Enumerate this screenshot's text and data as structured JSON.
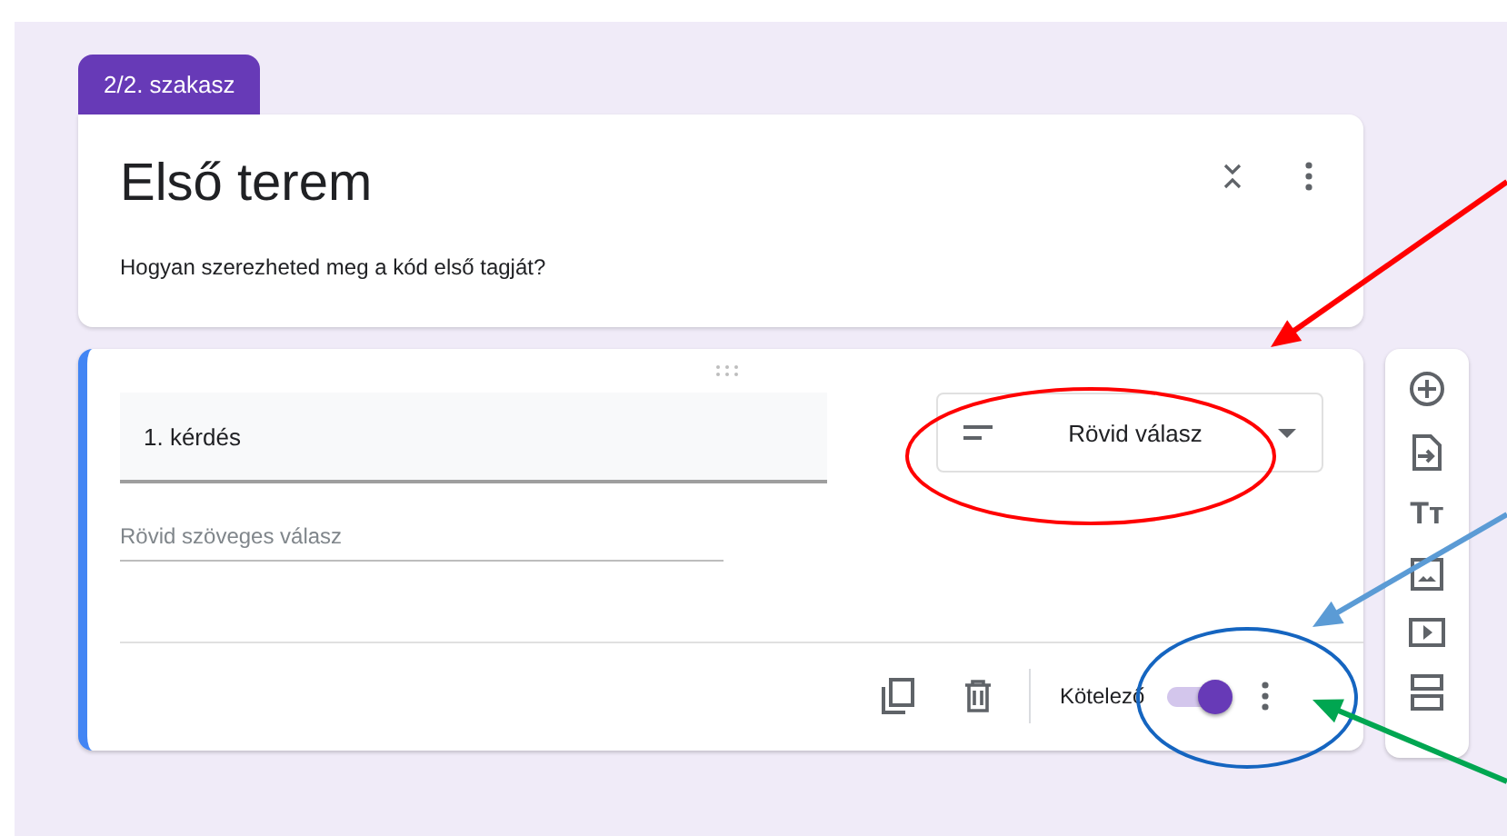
{
  "section_tab": {
    "label": "2/2. szakasz"
  },
  "section": {
    "title": "Első terem",
    "description": "Hogyan szerezheted meg a kód első tagját?"
  },
  "question": {
    "title": "1. kérdés",
    "type": "Rövid válasz",
    "answer_placeholder": "Rövid szöveges válasz",
    "required_label": "Kötelező",
    "required": true
  },
  "toolbar": [
    {
      "kind": "add"
    },
    {
      "kind": "import"
    },
    {
      "kind": "title",
      "glyph": "Tт"
    },
    {
      "kind": "image"
    },
    {
      "kind": "video"
    },
    {
      "kind": "section"
    }
  ],
  "annotations": [
    {
      "kind": "arrow",
      "color": "#ff0000"
    },
    {
      "kind": "ellipse",
      "color": "#ff0000"
    },
    {
      "kind": "arrow",
      "color": "#5b9bd5"
    },
    {
      "kind": "ellipse",
      "color": "#1565c0"
    },
    {
      "kind": "arrow",
      "color": "#00a651"
    }
  ]
}
